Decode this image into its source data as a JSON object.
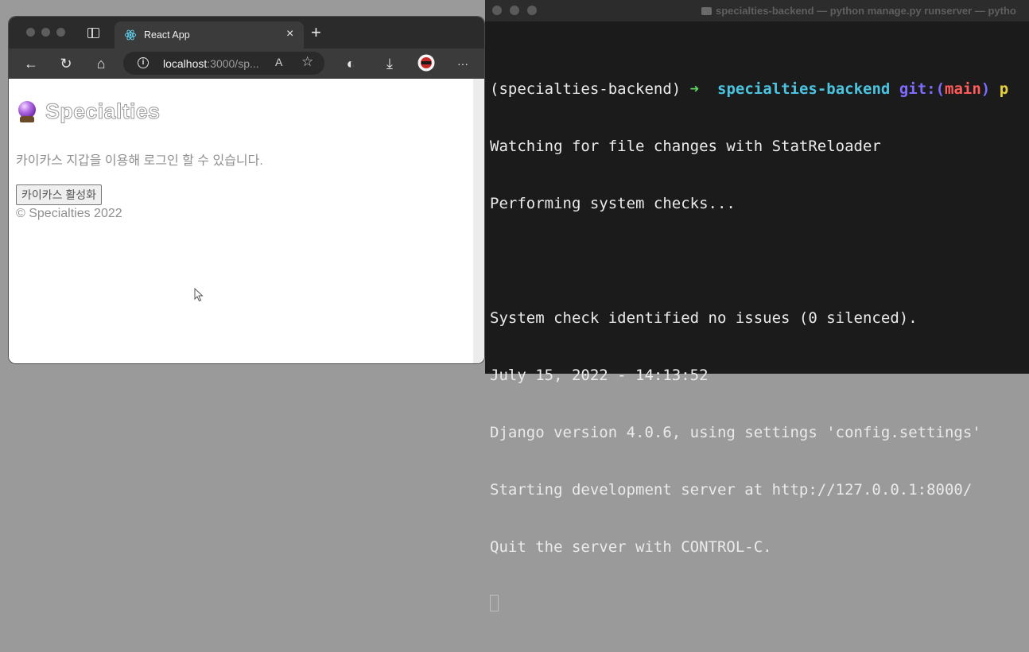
{
  "browser": {
    "tab": {
      "title": "React App",
      "close_glyph": "×"
    },
    "new_tab_glyph": "+",
    "toolbar": {
      "back_glyph": "←",
      "refresh_glyph": "↻",
      "home_glyph": "⌂",
      "url_host": "localhost",
      "url_rest": ":3000/sp...",
      "read_aloud_glyph": "A",
      "favorite_glyph": "☆",
      "extension_glyph": "◐",
      "download_glyph": "⤓",
      "more_glyph": "···"
    },
    "page": {
      "title": "Specialties",
      "description": "카이카스 지갑을 이용해 로그인 할 수 있습니다.",
      "button_label": "카이카스 활성화",
      "footer": "© Specialties 2022"
    }
  },
  "terminal": {
    "window_title": "specialties-backend — python manage.py runserver — pytho",
    "prompt": {
      "venv": "(specialties-backend)",
      "arrow": "➜",
      "dir": "specialties-backend",
      "git_label": "git:",
      "branch_open": "(",
      "branch": "main",
      "branch_close": ")",
      "overflow": "p"
    },
    "lines": [
      "Watching for file changes with StatReloader",
      "Performing system checks...",
      "",
      "System check identified no issues (0 silenced).",
      "July 15, 2022 - 14:13:52",
      "Django version 4.0.6, using settings 'config.settings'",
      "Starting development server at http://127.0.0.1:8000/",
      "Quit the server with CONTROL-C."
    ]
  },
  "colors": {
    "prompt_arrow": "#5fd35f",
    "prompt_dir": "#4cc4e0",
    "git_label": "#7e6bff",
    "branch": "#ff5b5b"
  }
}
